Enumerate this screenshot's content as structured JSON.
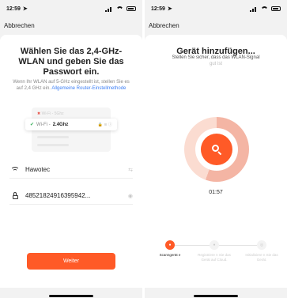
{
  "left_screen": {
    "status": {
      "time": "12:59"
    },
    "cancel_label": "Abbrechen",
    "title": "Wählen Sie das 2,4-GHz-WLAN und geben Sie das Passwort ein.",
    "subtitle": "Wenn Ihr WLAN auf 5-GHz eingestellt ist, stellen Sie es auf 2,4 GHz ein.",
    "subtitle_link": "Allgemeine Router-Einstellmethode",
    "illustration": {
      "row_5ghz": "Wi-Fi - 5Ghz",
      "row_24_prefix": "Wi-Fi - ",
      "row_24_band": "2.4Ghz"
    },
    "ssid_value": "Hawotec",
    "password_value": "48521824916395942...",
    "next_button": "Weiter"
  },
  "right_screen": {
    "status": {
      "time": "12:59"
    },
    "cancel_label": "Abbrechen",
    "title": "Gerät hinzufügen...",
    "subtitle": "Stellen Sie sicher, dass das WLAN-Signal",
    "subtitle_faded": "gut ist",
    "timer": "01:57",
    "steps": [
      {
        "label": "Scanngerät e",
        "active": true
      },
      {
        "label": "Registriere n Sie das Gerät auf Cloud.",
        "active": false
      },
      {
        "label": "Initialisiere n Sie das Gerät.",
        "active": false
      }
    ]
  },
  "colors": {
    "accent": "#ff5a27",
    "link": "#3c7ff5",
    "check": "#3bb15d"
  }
}
